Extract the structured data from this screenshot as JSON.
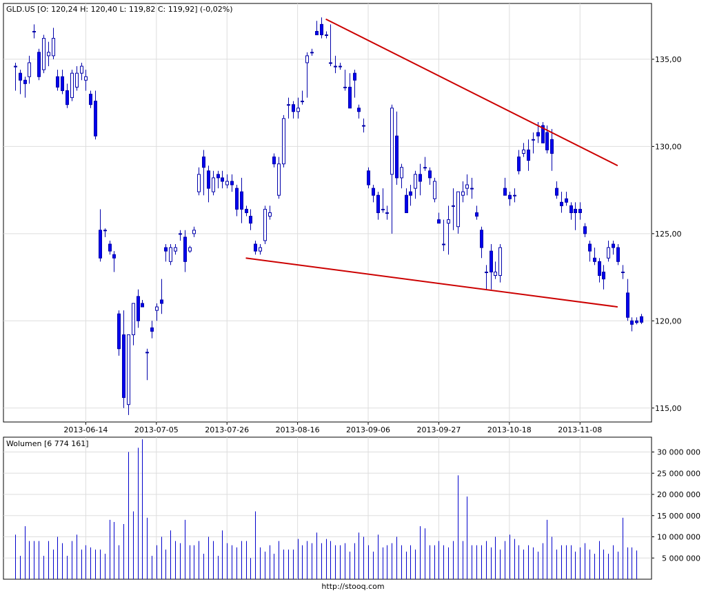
{
  "footer_url": "http://stooq.com",
  "chart_data": [
    {
      "type": "candlestick",
      "title": "GLD.US [O: 120,24  H: 120,40  L: 119,82  C: 119,92] (-0,02%)",
      "ylim": [
        114.2,
        138.2
      ],
      "y_ticks": [
        "135,00",
        "130,00",
        "125,00",
        "120,00",
        "115,00"
      ],
      "y_tick_values": [
        135,
        130,
        125,
        120,
        115
      ],
      "x_tick_labels": [
        "2013-06-14",
        "2013-07-05",
        "2013-07-26",
        "2013-08-16",
        "2013-09-06",
        "2013-09-27",
        "2013-10-18",
        "2013-11-08"
      ],
      "x_tick_indices": [
        15,
        30,
        45,
        60,
        75,
        90,
        105,
        120
      ],
      "grid": true,
      "colors": {
        "up": "#ffffff",
        "down": "#0000ee",
        "outline": "#0000aa",
        "trendline": "#cc0000",
        "grid": "#dddddd"
      },
      "candles_ohlc": [
        [
          134.6,
          134.8,
          133.2,
          134.6
        ],
        [
          134.2,
          134.4,
          133.0,
          133.8
        ],
        [
          133.8,
          134.0,
          132.8,
          133.6
        ],
        [
          134.0,
          135.2,
          133.6,
          134.8
        ],
        [
          136.6,
          137.0,
          136.2,
          136.6
        ],
        [
          135.4,
          135.6,
          133.8,
          134.0
        ],
        [
          134.4,
          136.4,
          134.2,
          136.2
        ],
        [
          135.2,
          136.0,
          134.6,
          135.4
        ],
        [
          135.2,
          136.8,
          135.0,
          136.2
        ],
        [
          134.0,
          134.4,
          133.2,
          133.4
        ],
        [
          134.0,
          134.4,
          133.0,
          133.2
        ],
        [
          133.2,
          133.6,
          132.2,
          132.4
        ],
        [
          132.8,
          134.4,
          132.6,
          134.2
        ],
        [
          133.4,
          134.6,
          133.2,
          134.2
        ],
        [
          134.2,
          134.8,
          133.8,
          134.6
        ],
        [
          133.8,
          134.4,
          133.2,
          134.0
        ],
        [
          133.0,
          133.2,
          132.2,
          132.4
        ],
        [
          132.6,
          133.2,
          130.4,
          130.6
        ],
        [
          125.2,
          126.4,
          123.4,
          123.6
        ],
        [
          125.2,
          125.3,
          124.8,
          125.2
        ],
        [
          124.4,
          124.6,
          123.8,
          124.0
        ],
        [
          123.8,
          124.0,
          122.8,
          123.6
        ],
        [
          120.4,
          120.6,
          118.0,
          118.4
        ],
        [
          119.2,
          120.6,
          115.0,
          115.6
        ],
        [
          115.2,
          119.2,
          114.6,
          119.2
        ],
        [
          119.2,
          121.0,
          118.6,
          121.0
        ],
        [
          121.4,
          121.8,
          119.6,
          120.0
        ],
        [
          121.0,
          121.2,
          120.8,
          120.8
        ],
        [
          118.2,
          118.4,
          116.6,
          118.2
        ],
        [
          119.6,
          120.0,
          119.0,
          119.4
        ],
        [
          120.6,
          121.0,
          120.0,
          120.8
        ],
        [
          121.2,
          122.4,
          120.4,
          121.0
        ],
        [
          124.2,
          124.4,
          123.4,
          124.0
        ],
        [
          123.4,
          124.4,
          123.2,
          124.2
        ],
        [
          124.0,
          124.4,
          123.8,
          124.2
        ],
        [
          125.0,
          125.2,
          124.6,
          125.0
        ],
        [
          124.8,
          125.2,
          122.8,
          123.4
        ],
        [
          124.0,
          124.3,
          123.9,
          124.2
        ],
        [
          125.0,
          125.4,
          124.8,
          125.2
        ],
        [
          127.4,
          128.8,
          127.2,
          128.4
        ],
        [
          129.4,
          129.8,
          127.2,
          128.8
        ],
        [
          128.6,
          128.9,
          126.8,
          127.6
        ],
        [
          127.4,
          128.6,
          127.2,
          128.2
        ],
        [
          128.4,
          128.6,
          127.6,
          128.2
        ],
        [
          128.2,
          128.6,
          127.6,
          128.0
        ],
        [
          127.8,
          128.4,
          127.6,
          128.0
        ],
        [
          128.0,
          128.4,
          127.4,
          127.8
        ],
        [
          127.6,
          127.8,
          126.0,
          126.4
        ],
        [
          127.4,
          128.2,
          125.6,
          126.4
        ],
        [
          126.4,
          126.6,
          126.0,
          126.2
        ],
        [
          126.0,
          126.4,
          125.2,
          125.6
        ],
        [
          124.4,
          124.6,
          123.8,
          124.0
        ],
        [
          124.0,
          124.4,
          123.8,
          124.2
        ],
        [
          124.6,
          126.6,
          124.4,
          126.4
        ],
        [
          126.0,
          126.6,
          125.8,
          126.2
        ],
        [
          129.4,
          129.6,
          128.8,
          129.0
        ],
        [
          127.2,
          129.4,
          127.0,
          129.0
        ],
        [
          129.0,
          131.8,
          128.8,
          131.6
        ],
        [
          132.4,
          132.8,
          131.6,
          132.4
        ],
        [
          132.4,
          132.6,
          131.6,
          132.0
        ],
        [
          132.0,
          132.8,
          131.6,
          132.2
        ],
        [
          132.6,
          133.2,
          132.4,
          132.6
        ],
        [
          134.8,
          135.4,
          132.8,
          135.2
        ],
        [
          135.4,
          135.6,
          135.2,
          135.4
        ],
        [
          136.6,
          137.2,
          136.4,
          136.4
        ],
        [
          137.0,
          137.4,
          136.2,
          136.4
        ],
        [
          136.4,
          136.6,
          136.2,
          136.4
        ],
        [
          134.8,
          137.0,
          134.6,
          134.8
        ],
        [
          134.6,
          135.2,
          134.2,
          134.6
        ],
        [
          134.6,
          134.8,
          134.4,
          134.6
        ],
        [
          133.4,
          134.4,
          133.2,
          133.4
        ],
        [
          133.4,
          134.2,
          132.8,
          132.2
        ],
        [
          134.2,
          134.4,
          132.8,
          133.8
        ],
        [
          132.2,
          132.4,
          131.6,
          132.0
        ],
        [
          131.2,
          131.6,
          130.8,
          131.2
        ],
        [
          128.6,
          128.8,
          127.6,
          127.8
        ],
        [
          127.6,
          127.8,
          126.8,
          127.2
        ],
        [
          127.2,
          127.4,
          125.8,
          126.2
        ],
        [
          126.4,
          127.6,
          126.2,
          126.4
        ],
        [
          126.2,
          126.6,
          125.8,
          126.2
        ],
        [
          128.4,
          132.4,
          125.0,
          132.2
        ],
        [
          130.6,
          132.0,
          127.8,
          128.2
        ],
        [
          128.2,
          129.0,
          127.6,
          128.8
        ],
        [
          127.2,
          127.6,
          126.4,
          126.2
        ],
        [
          127.4,
          127.8,
          126.6,
          127.2
        ],
        [
          127.6,
          128.6,
          127.0,
          128.4
        ],
        [
          128.4,
          129.0,
          127.2,
          128.0
        ],
        [
          128.8,
          129.4,
          128.6,
          128.8
        ],
        [
          128.6,
          128.8,
          127.8,
          128.2
        ],
        [
          127.0,
          128.2,
          126.8,
          128.0
        ],
        [
          125.8,
          126.2,
          125.6,
          125.6
        ],
        [
          124.4,
          125.8,
          124.0,
          124.4
        ],
        [
          125.6,
          126.6,
          123.8,
          125.8
        ],
        [
          126.6,
          127.6,
          125.2,
          126.6
        ],
        [
          125.4,
          127.4,
          125.0,
          127.4
        ],
        [
          127.2,
          128.0,
          126.8,
          127.4
        ],
        [
          127.6,
          128.4,
          127.2,
          127.8
        ],
        [
          127.6,
          128.2,
          127.0,
          127.6
        ],
        [
          126.2,
          126.6,
          125.8,
          126.0
        ],
        [
          125.2,
          125.4,
          123.6,
          124.2
        ],
        [
          122.8,
          123.2,
          121.8,
          122.8
        ],
        [
          124.0,
          124.4,
          121.8,
          122.8
        ],
        [
          122.6,
          123.4,
          122.4,
          122.8
        ],
        [
          122.6,
          124.4,
          122.2,
          124.2
        ],
        [
          127.6,
          128.2,
          127.2,
          127.2
        ],
        [
          127.2,
          127.4,
          126.6,
          127.0
        ],
        [
          127.2,
          127.6,
          126.8,
          127.2
        ],
        [
          129.4,
          129.8,
          128.4,
          128.6
        ],
        [
          129.6,
          130.2,
          129.4,
          129.8
        ],
        [
          129.8,
          130.4,
          128.6,
          129.2
        ],
        [
          130.4,
          130.8,
          129.6,
          130.4
        ],
        [
          130.8,
          131.4,
          130.2,
          130.6
        ],
        [
          131.2,
          131.4,
          130.2,
          130.2
        ],
        [
          130.8,
          131.2,
          129.6,
          129.8
        ],
        [
          130.4,
          131.0,
          128.6,
          129.6
        ],
        [
          127.6,
          128.0,
          127.0,
          127.2
        ],
        [
          126.8,
          127.4,
          126.2,
          126.6
        ],
        [
          127.0,
          127.4,
          126.6,
          126.8
        ],
        [
          126.6,
          126.8,
          125.8,
          126.2
        ],
        [
          126.4,
          126.8,
          125.2,
          126.2
        ],
        [
          126.4,
          126.8,
          125.8,
          126.2
        ],
        [
          125.4,
          125.6,
          124.8,
          125.0
        ],
        [
          124.4,
          124.6,
          123.4,
          124.0
        ],
        [
          123.6,
          124.2,
          123.2,
          123.4
        ],
        [
          123.4,
          123.6,
          122.2,
          122.6
        ],
        [
          122.8,
          123.2,
          121.8,
          122.4
        ],
        [
          123.6,
          124.6,
          123.4,
          124.2
        ],
        [
          124.4,
          124.6,
          123.8,
          124.2
        ],
        [
          124.2,
          124.4,
          123.2,
          123.4
        ],
        [
          122.8,
          123.2,
          122.4,
          122.8
        ],
        [
          121.6,
          122.4,
          120.0,
          120.2
        ],
        [
          120.0,
          120.2,
          119.4,
          119.8
        ],
        [
          120.0,
          120.2,
          119.8,
          119.9
        ],
        [
          120.24,
          120.4,
          119.82,
          119.92
        ]
      ],
      "trendlines": [
        {
          "name": "upper",
          "from": [
            66,
            137.3
          ],
          "to": [
            128,
            128.9
          ]
        },
        {
          "name": "lower",
          "from": [
            49,
            123.6
          ],
          "to": [
            128,
            120.8
          ]
        }
      ]
    },
    {
      "type": "bar",
      "title": "Wolumen [6 774 161]",
      "ylim": [
        0,
        33500000
      ],
      "y_ticks": [
        "30 000 000",
        "25 000 000",
        "20 000 000",
        "15 000 000",
        "10 000 000",
        "5 000 000"
      ],
      "y_tick_values": [
        30000000,
        25000000,
        20000000,
        15000000,
        10000000,
        5000000
      ],
      "colors": {
        "bar": "#0000cc",
        "grid": "#dddddd"
      },
      "values": [
        10500000,
        5500000,
        12500000,
        9000000,
        9000000,
        9000000,
        5500000,
        9000000,
        7000000,
        10000000,
        8500000,
        5500000,
        9000000,
        10500000,
        7000000,
        8000000,
        7500000,
        7000000,
        7000000,
        6000000,
        14000000,
        13500000,
        8000000,
        13000000,
        30000000,
        16000000,
        31000000,
        33000000,
        14500000,
        5500000,
        8000000,
        10000000,
        7000000,
        11500000,
        9000000,
        8500000,
        14000000,
        8000000,
        8000000,
        9000000,
        6000000,
        10000000,
        9000000,
        5500000,
        11500000,
        8500000,
        8000000,
        7500000,
        9000000,
        9000000,
        5000000,
        16000000,
        7500000,
        6500000,
        8000000,
        6000000,
        9000000,
        7000000,
        7000000,
        7000000,
        9500000,
        8000000,
        9000000,
        8500000,
        11000000,
        8500000,
        9500000,
        9000000,
        8000000,
        8000000,
        8500000,
        6500000,
        8500000,
        11000000,
        10000000,
        8000000,
        6500000,
        10500000,
        7500000,
        8000000,
        8500000,
        10000000,
        8000000,
        6500000,
        8000000,
        7000000,
        12500000,
        12000000,
        8000000,
        8000000,
        9000000,
        8000000,
        7500000,
        9000000,
        24500000,
        9000000,
        19500000,
        8000000,
        8000000,
        8000000,
        9000000,
        7500000,
        10000000,
        7000000,
        9000000,
        10500000,
        9500000,
        8000000,
        7000000,
        8000000,
        7500000,
        6500000,
        8500000,
        14000000,
        10000000,
        7000000,
        8000000,
        8000000,
        8000000,
        6500000,
        7500000,
        8500000,
        7000000,
        6000000,
        9000000,
        7000000,
        6000000,
        8000000,
        6500000,
        14500000,
        7500000,
        7500000,
        6774161
      ]
    }
  ]
}
